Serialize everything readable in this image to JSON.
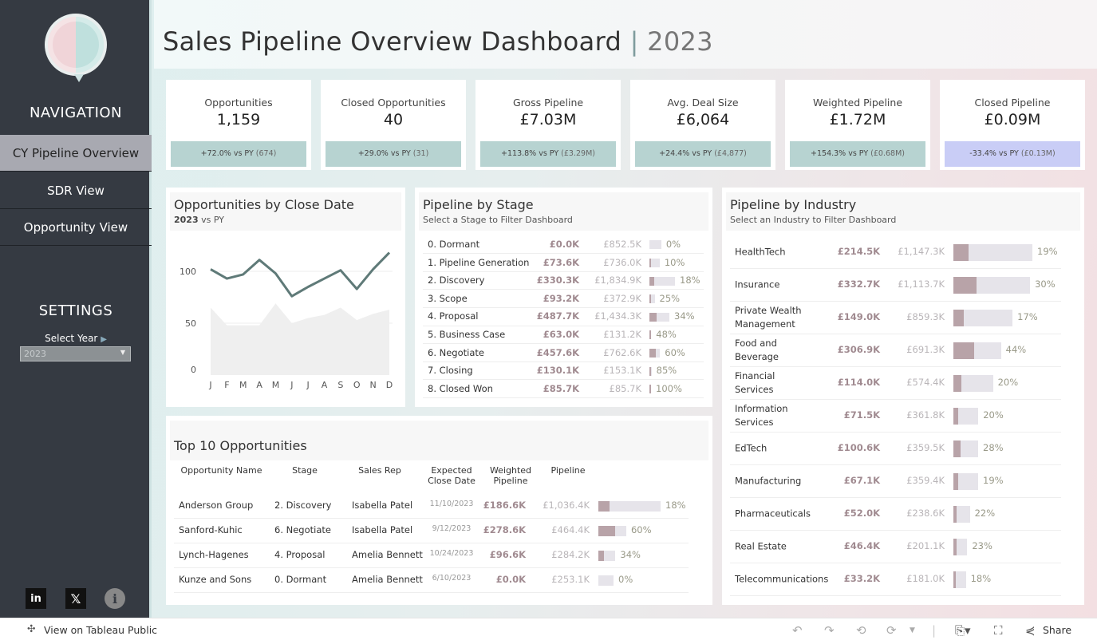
{
  "sidebar": {
    "nav_heading": "NAVIGATION",
    "nav_items": [
      {
        "label": "CY Pipeline Overview",
        "active": true
      },
      {
        "label": "SDR View"
      },
      {
        "label": "Opportunity View"
      }
    ],
    "settings_heading": "SETTINGS",
    "select_year_label": "Select Year",
    "select_year_value": "2023",
    "social": [
      "linkedin-icon",
      "x-icon",
      "info-icon"
    ]
  },
  "header": {
    "title": "Sales Pipeline Overview Dashboard",
    "separator": "|",
    "year": "2023"
  },
  "kpis": [
    {
      "label": "Opportunities",
      "value": "1,159",
      "change": "+72.0% vs PY",
      "py": "(674)",
      "color": "#b7d3d1"
    },
    {
      "label": "Closed Opportunities",
      "value": "40",
      "change": "+29.0% vs PY",
      "py": "(31)",
      "color": "#b7d3d1"
    },
    {
      "label": "Gross Pipeline",
      "value": "£7.03M",
      "change": "+113.8% vs PY",
      "py": "(£3.29M)",
      "color": "#b7d3d1"
    },
    {
      "label": "Avg. Deal Size",
      "value": "£6,064",
      "change": "+24.4% vs PY",
      "py": "(£4,877)",
      "color": "#b7d3d1"
    },
    {
      "label": "Weighted Pipeline",
      "value": "£1.72M",
      "change": "+154.3% vs PY",
      "py": "(£0.68M)",
      "color": "#b7d3d1"
    },
    {
      "label": "Closed Pipeline",
      "value": "£0.09M",
      "change": "-33.4% vs PY",
      "py": "(£0.13M)",
      "color": "#c9cdf6"
    }
  ],
  "close_date": {
    "title": "Opportunities by Close Date",
    "subtitle_cy": "2023",
    "subtitle_rest": "vs PY"
  },
  "chart_data": {
    "type": "line",
    "categories": [
      "J",
      "F",
      "M",
      "A",
      "M",
      "J",
      "J",
      "A",
      "S",
      "O",
      "N",
      "D"
    ],
    "series": [
      {
        "values": [
          102,
          93,
          97,
          111,
          98,
          76,
          85,
          93,
          101,
          83,
          102,
          118
        ],
        "color": "#5f7a78",
        "style": "line"
      },
      {
        "values": [
          65,
          48,
          48,
          48,
          69,
          50,
          55,
          58,
          65,
          53,
          59,
          63
        ],
        "color": "#efefef",
        "style": "area"
      }
    ],
    "yticks": [
      0,
      50,
      100
    ],
    "ylim": [
      0,
      125
    ],
    "grid": true
  },
  "stage": {
    "title": "Pipeline by Stage",
    "subtitle_pre": "Select a Stage to",
    "subtitle_bold": "Filter Dashboard",
    "rows": [
      {
        "name": "0. Dormant",
        "weighted": "£0.0K",
        "pipeline": "£852.5K",
        "w": 0,
        "p": 852.5,
        "pct": "0%"
      },
      {
        "name": "1. Pipeline Generation",
        "weighted": "£73.6K",
        "pipeline": "£736.0K",
        "w": 73.6,
        "p": 736.0,
        "pct": "10%"
      },
      {
        "name": "2. Discovery",
        "weighted": "£330.3K",
        "pipeline": "£1,834.9K",
        "w": 330.3,
        "p": 1834.9,
        "pct": "18%"
      },
      {
        "name": "3. Scope",
        "weighted": "£93.2K",
        "pipeline": "£372.9K",
        "w": 93.2,
        "p": 372.9,
        "pct": "25%"
      },
      {
        "name": "4. Proposal",
        "weighted": "£487.7K",
        "pipeline": "£1,434.3K",
        "w": 487.7,
        "p": 1434.3,
        "pct": "34%"
      },
      {
        "name": "5. Business Case",
        "weighted": "£63.0K",
        "pipeline": "£131.2K",
        "w": 63.0,
        "p": 131.2,
        "pct": "48%"
      },
      {
        "name": "6. Negotiate",
        "weighted": "£457.6K",
        "pipeline": "£762.6K",
        "w": 457.6,
        "p": 762.6,
        "pct": "60%"
      },
      {
        "name": "7. Closing",
        "weighted": "£130.1K",
        "pipeline": "£153.1K",
        "w": 130.1,
        "p": 153.1,
        "pct": "85%"
      },
      {
        "name": "8. Closed Won",
        "weighted": "£85.7K",
        "pipeline": "£85.7K",
        "w": 85.7,
        "p": 85.7,
        "pct": "100%"
      }
    ]
  },
  "industry": {
    "title": "Pipeline by Industry",
    "subtitle_pre": "Select an Industry to",
    "subtitle_bold": "Filter Dashboard",
    "rows": [
      {
        "name": "HealthTech",
        "weighted": "£214.5K",
        "pipeline": "£1,147.3K",
        "w": 214.5,
        "p": 1147.3,
        "pct": "19%"
      },
      {
        "name": "Insurance",
        "weighted": "£332.7K",
        "pipeline": "£1,113.7K",
        "w": 332.7,
        "p": 1113.7,
        "pct": "30%"
      },
      {
        "name": "Private Wealth Management",
        "weighted": "£149.0K",
        "pipeline": "£859.3K",
        "w": 149.0,
        "p": 859.3,
        "pct": "17%"
      },
      {
        "name": "Food and Beverage",
        "weighted": "£306.9K",
        "pipeline": "£691.3K",
        "w": 306.9,
        "p": 691.3,
        "pct": "44%"
      },
      {
        "name": "Financial Services",
        "weighted": "£114.0K",
        "pipeline": "£574.4K",
        "w": 114.0,
        "p": 574.4,
        "pct": "20%"
      },
      {
        "name": "Information Services",
        "weighted": "£71.5K",
        "pipeline": "£361.8K",
        "w": 71.5,
        "p": 361.8,
        "pct": "20%"
      },
      {
        "name": "EdTech",
        "weighted": "£100.6K",
        "pipeline": "£359.5K",
        "w": 100.6,
        "p": 359.5,
        "pct": "28%"
      },
      {
        "name": "Manufacturing",
        "weighted": "£67.1K",
        "pipeline": "£359.4K",
        "w": 67.1,
        "p": 359.4,
        "pct": "19%"
      },
      {
        "name": "Pharmaceuticals",
        "weighted": "£52.0K",
        "pipeline": "£238.6K",
        "w": 52.0,
        "p": 238.6,
        "pct": "22%"
      },
      {
        "name": "Real Estate",
        "weighted": "£46.4K",
        "pipeline": "£201.1K",
        "w": 46.4,
        "p": 201.1,
        "pct": "23%"
      },
      {
        "name": "Telecommunications",
        "weighted": "£33.2K",
        "pipeline": "£181.0K",
        "w": 33.2,
        "p": 181.0,
        "pct": "18%"
      }
    ]
  },
  "top10": {
    "title": "Top 10 Opportunities",
    "headers": [
      "Opportunity Name",
      "Stage",
      "Sales Rep",
      "Expected Close Date",
      "Weighted Pipeline",
      "Pipeline"
    ],
    "rows": [
      {
        "name": "Anderson Group",
        "stage": "2. Discovery",
        "rep": "Isabella Patel",
        "date": "11/10/2023",
        "weighted": "£186.6K",
        "pipeline": "£1,036.4K",
        "w": 186.6,
        "p": 1036.4,
        "pct": "18%"
      },
      {
        "name": "Sanford-Kuhic",
        "stage": "6. Negotiate",
        "rep": "Isabella Patel",
        "date": "9/12/2023",
        "weighted": "£278.6K",
        "pipeline": "£464.4K",
        "w": 278.6,
        "p": 464.4,
        "pct": "60%"
      },
      {
        "name": "Lynch-Hagenes",
        "stage": "4. Proposal",
        "rep": "Amelia Bennett",
        "date": "10/24/2023",
        "weighted": "£96.6K",
        "pipeline": "£284.2K",
        "w": 96.6,
        "p": 284.2,
        "pct": "34%"
      },
      {
        "name": "Kunze and Sons",
        "stage": "0. Dormant",
        "rep": "Amelia Bennett",
        "date": "6/10/2023",
        "weighted": "£0.0K",
        "pipeline": "£253.1K",
        "w": 0,
        "p": 253.1,
        "pct": "0%"
      }
    ]
  },
  "footer": {
    "view_label": "View on Tableau Public",
    "share_label": "Share"
  }
}
